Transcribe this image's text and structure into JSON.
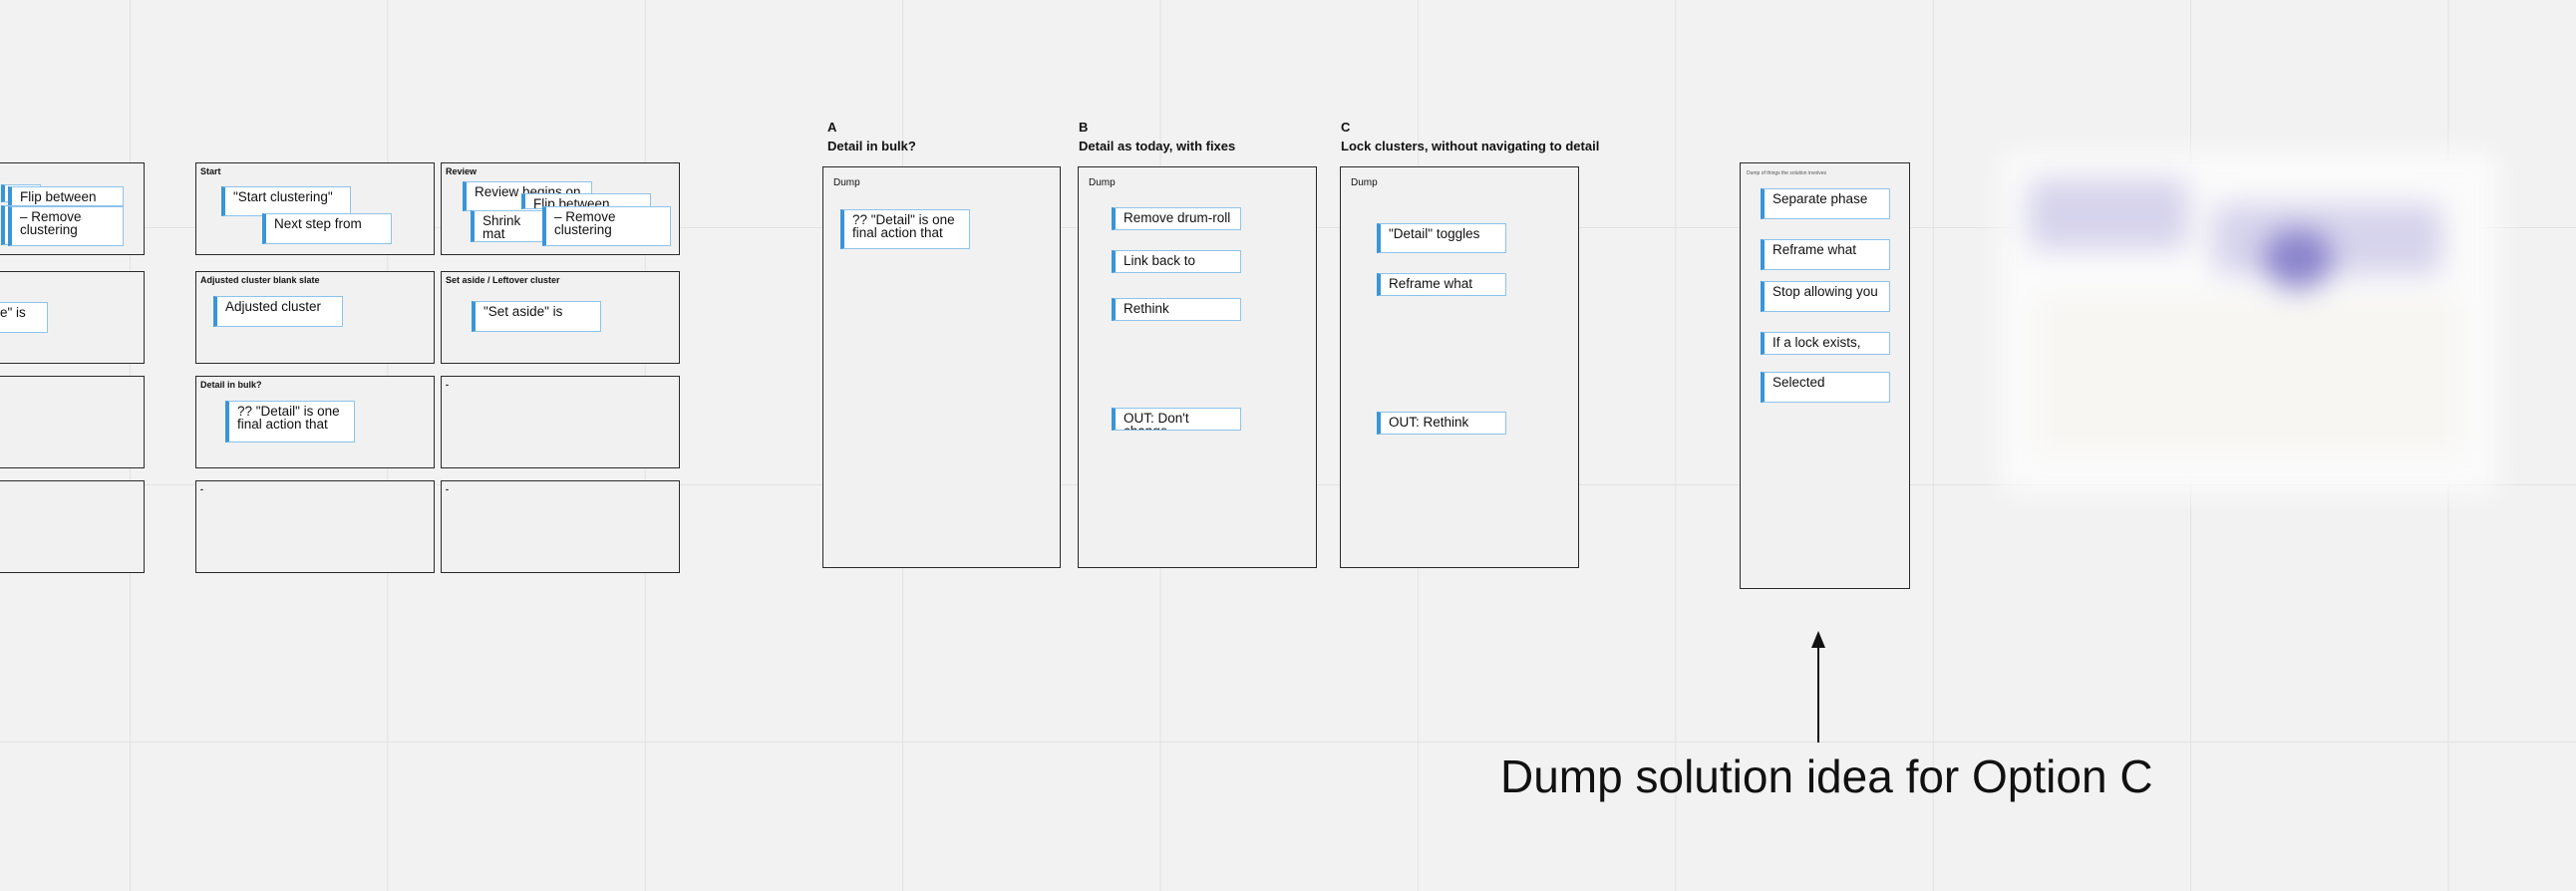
{
  "left_frames": [
    {
      "title": "",
      "stickies": [
        "Flip between",
        "– Remove clustering"
      ]
    },
    {
      "title": "",
      "stickies": [
        "e\" is"
      ]
    },
    {
      "title": "",
      "stickies": []
    },
    {
      "title": "",
      "stickies": []
    }
  ],
  "grid_frames": [
    {
      "title": "Start",
      "stickies": [
        "\"Start clustering\"",
        "Next step from"
      ]
    },
    {
      "title": "Review",
      "stickies": [
        "Review begins on",
        "Shrink mat",
        "Flip between",
        "– Remove clustering"
      ]
    },
    {
      "title": "Adjusted cluster blank slate",
      "stickies": [
        "Adjusted cluster"
      ]
    },
    {
      "title": "Set aside / Leftover cluster",
      "stickies": [
        "\"Set aside\" is"
      ]
    },
    {
      "title": "Detail in bulk?",
      "stickies": [
        "?? \"Detail\" is one final action that"
      ]
    },
    {
      "title": "-",
      "stickies": []
    },
    {
      "title": "-",
      "stickies": []
    },
    {
      "title": "-",
      "stickies": []
    }
  ],
  "columns": [
    {
      "letter": "A",
      "title": "Detail in bulk?",
      "frame_title": "Dump",
      "stickies": [
        "?? \"Detail\" is one final action that"
      ]
    },
    {
      "letter": "B",
      "title": "Detail as today, with fixes",
      "frame_title": "Dump",
      "stickies": [
        "Remove drum-roll",
        "Link back to",
        "Rethink",
        "OUT: Don't change"
      ]
    },
    {
      "letter": "C",
      "title": "Lock clusters, without navigating to detail",
      "frame_title": "Dump",
      "stickies": [
        "\"Detail\" toggles",
        "Reframe what",
        "OUT: Rethink"
      ]
    }
  ],
  "dump_frame": {
    "title": "Dump of things the solution involves",
    "stickies": [
      "Separate phase",
      "Reframe what",
      "Stop allowing you",
      "If a lock exists,",
      "Selected"
    ]
  },
  "annotation": {
    "label": "Dump solution idea for Option C"
  },
  "colors": {
    "sticky_accent": "#3a95d8",
    "sticky_border": "#8ec3ea",
    "frame_border": "#2a2a2a",
    "canvas": "#f2f2f2"
  }
}
